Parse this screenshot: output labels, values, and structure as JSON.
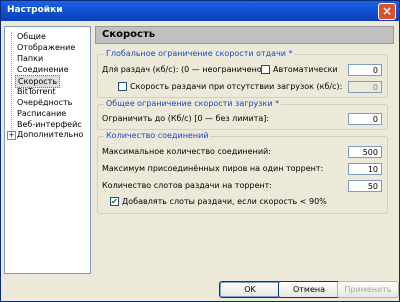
{
  "window": {
    "title": "Настройки",
    "close": "×"
  },
  "sidebar": {
    "items": [
      {
        "label": "Общие"
      },
      {
        "label": "Отображение"
      },
      {
        "label": "Папки"
      },
      {
        "label": "Соединение"
      },
      {
        "label": "Скорость"
      },
      {
        "label": "BitTorrent"
      },
      {
        "label": "Очерёдность"
      },
      {
        "label": "Расписание"
      },
      {
        "label": "Веб-интерфейс"
      },
      {
        "label": "Дополнительно"
      }
    ],
    "expander": "+"
  },
  "main": {
    "header": "Скорость",
    "upload_group": {
      "title": "Глобальное ограничение скорости отдачи *",
      "upload_label": "Для раздач (кб/с): (0 — неограничено)",
      "auto_label": "Автоматически",
      "upload_value": "0",
      "no_downloads_label": "Скорость раздачи при отсутствии загрузок (кб/с):",
      "no_downloads_value": "0"
    },
    "download_group": {
      "title": "Общее ограничение скорости загрузки *",
      "limit_label": "Ограничить до (Кб/с) [0 — без лимита]:",
      "limit_value": "0"
    },
    "connections_group": {
      "title": "Количество соединений",
      "max_conn_label": "Максимальное количество соединений:",
      "max_conn_value": "500",
      "max_peers_label": "Максимум присоединённых пиров на один торрент:",
      "max_peers_value": "10",
      "upload_slots_label": "Количество слотов раздачи на торрент:",
      "upload_slots_value": "50",
      "extra_slots_label": "Добавлять слоты раздачи, если скорость < 90%",
      "check": "✔"
    }
  },
  "buttons": {
    "ok": "OK",
    "cancel": "Отмена",
    "apply": "Применить"
  }
}
